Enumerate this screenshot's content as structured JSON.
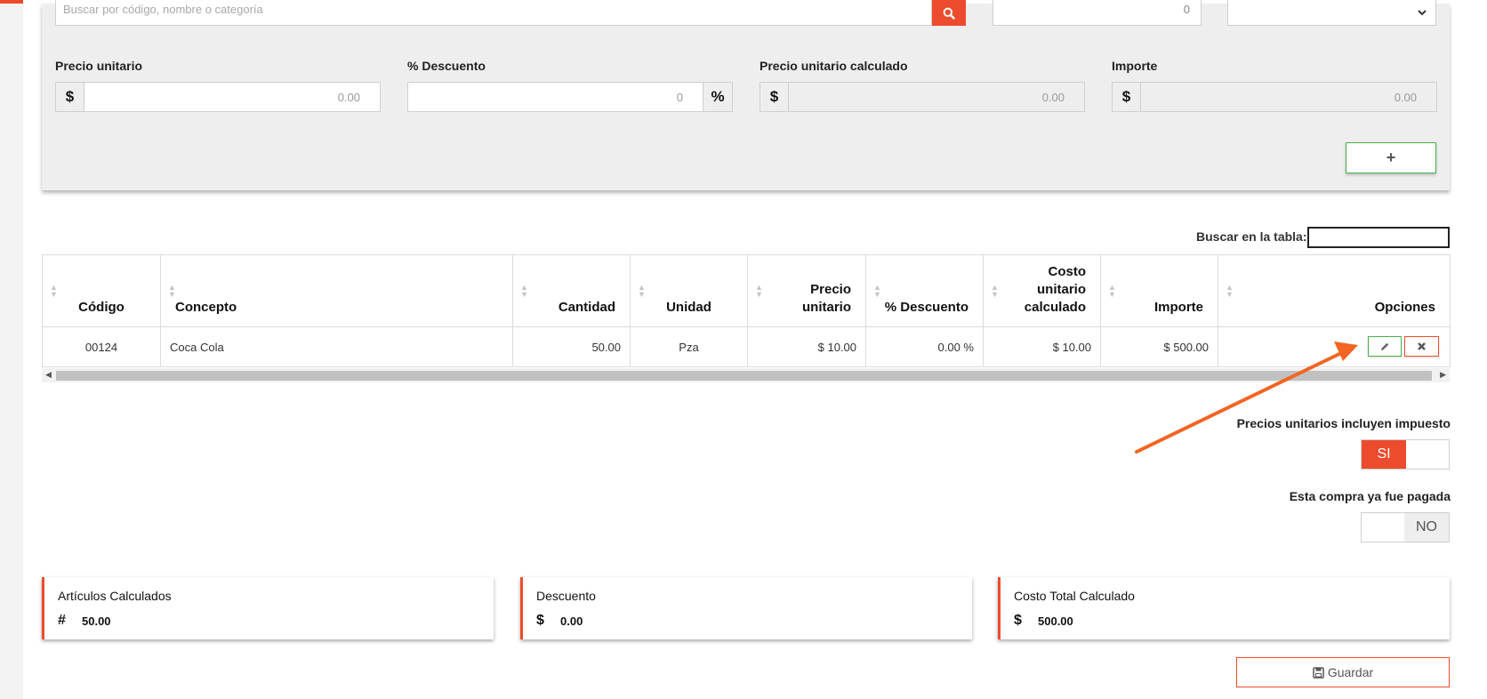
{
  "form": {
    "search_placeholder": "Buscar por código, nombre o categoría",
    "quantity_value": "0",
    "unit_price_label": "Precio unitario",
    "unit_price_value": "0.00",
    "discount_label": "% Descuento",
    "discount_value": "0",
    "calc_price_label": "Precio unitario calculado",
    "calc_price_value": "0.00",
    "amount_label": "Importe",
    "amount_value": "0.00",
    "currency_symbol": "$",
    "percent_symbol": "%",
    "add_button_label": "+"
  },
  "table_search": {
    "label": "Buscar en la tabla:"
  },
  "table": {
    "columns": [
      "Código",
      "Concepto",
      "Cantidad",
      "Unidad",
      "Precio unitario",
      "% Descuento",
      "Costo unitario calculado",
      "Importe",
      "Opciones"
    ],
    "rows": [
      [
        "00124",
        "Coca Cola",
        "50.00",
        "Pza",
        "$ 10.00",
        "0.00 %",
        "$ 10.00",
        "$ 500.00",
        ""
      ]
    ]
  },
  "toggles": {
    "tax_included_label": "Precios unitarios incluyen impuesto",
    "tax_included_value": "SI",
    "paid_label": "Esta compra ya fue pagada",
    "paid_value": "NO"
  },
  "summary": {
    "articles_title": "Artículos Calculados",
    "articles_icon": "#",
    "articles_value": "50.00",
    "discount_title": "Descuento",
    "discount_icon": "$",
    "discount_value": "0.00",
    "total_title": "Costo Total Calculado",
    "total_icon": "$",
    "total_value": "500.00"
  },
  "save_button_label": "Guardar",
  "colors": {
    "accent": "#ec4c2d",
    "success": "#4cae4c",
    "panel": "#eeeeee"
  }
}
